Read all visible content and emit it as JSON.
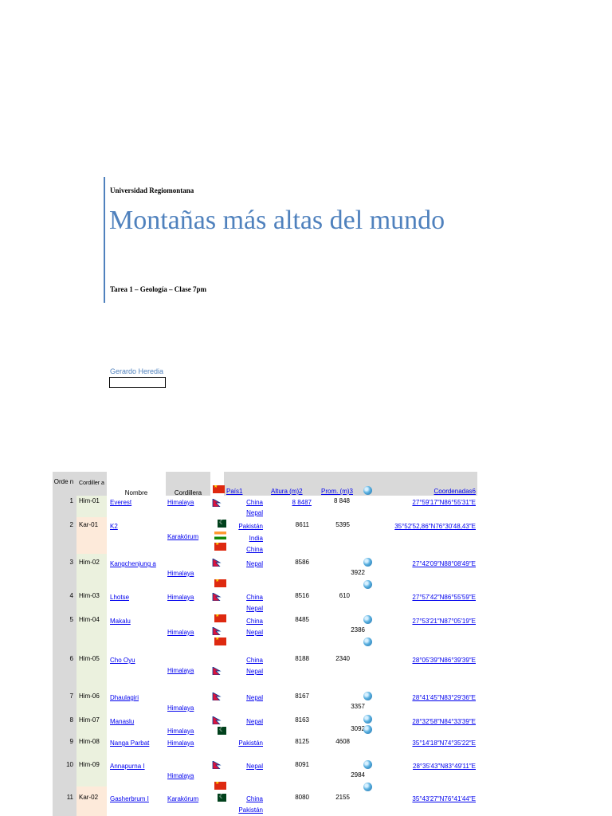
{
  "cover": {
    "organization": "Universidad Regiomontana",
    "title": "Montañas más altas del mundo",
    "subtitle": "Tarea 1 – Geología – Clase 7pm",
    "author": "Gerardo Heredia"
  },
  "table": {
    "headers": {
      "orden": "Orde n",
      "cordillera_code": "Cordiller a",
      "nombre": "Nombre",
      "cordillera": "Cordillera",
      "pais": "País1",
      "altura": "Altura (m)2",
      "prominencia": "Prom. (m)3",
      "coordenadas": "Coordenadas6"
    },
    "rows": [
      {
        "orden": "1",
        "code": "Him-01",
        "nombre": "Everest",
        "cordillera": "Himalaya",
        "paises": [
          "China",
          "Nepal"
        ],
        "altura": "8 8487",
        "prom": "8 848",
        "coord": "27°59′17″N86°55′31″E"
      },
      {
        "orden": "2",
        "code": "Kar-01",
        "nombre": "K2",
        "cordillera": "Karakórum",
        "paises": [
          "Pakistán",
          "India",
          "China"
        ],
        "altura": "8611",
        "prom": "5395",
        "coord": "35°52′52,86″N76°30′48,43″E"
      },
      {
        "orden": "3",
        "code": "Him-02",
        "nombre": "Kangchenjung a",
        "cordillera": "Himalaya",
        "paises": [
          "Nepal"
        ],
        "altura": "8586",
        "prom": "3922",
        "coord": "27°42′09″N88°08′49″E"
      },
      {
        "orden": "4",
        "code": "Him-03",
        "nombre": "Lhotse",
        "cordillera": "Himalaya",
        "paises": [
          "China",
          "Nepal"
        ],
        "altura": "8516",
        "prom": "610",
        "coord": "27°57′42″N86°55′59″E"
      },
      {
        "orden": "5",
        "code": "Him-04",
        "nombre": "Makalu",
        "cordillera": "Himalaya",
        "paises": [
          "China",
          "Nepal"
        ],
        "altura": "8485",
        "prom": "2386",
        "coord": "27°53′21″N87°05′19″E"
      },
      {
        "orden": "6",
        "code": "Him-05",
        "nombre": "Cho Oyu",
        "cordillera": "Himalaya",
        "paises": [
          "China",
          "Nepal"
        ],
        "altura": "8188",
        "prom": "2340",
        "coord": "28°05′39″N86°39′39″E"
      },
      {
        "orden": "7",
        "code": "Him-06",
        "nombre": "Dhaulagiri",
        "cordillera": "Himalaya",
        "paises": [
          "Nepal"
        ],
        "altura": "8167",
        "prom": "3357",
        "coord": "28°41′45″N83°29′36″E"
      },
      {
        "orden": "8",
        "code": "Him-07",
        "nombre": "Manaslu",
        "cordillera": "Himalaya",
        "paises": [
          "Nepal"
        ],
        "altura": "8163",
        "prom": "3092",
        "coord": "28°32′58″N84°33′39″E"
      },
      {
        "orden": "9",
        "code": "Him-08",
        "nombre": "Nanga Parbat",
        "cordillera": "Himalaya",
        "paises": [
          "Pakistán"
        ],
        "altura": "8125",
        "prom": "4608",
        "coord": "35°14′18″N74°35′22″E"
      },
      {
        "orden": "10",
        "code": "Him-09",
        "nombre": "Annapurna I",
        "cordillera": "Himalaya",
        "paises": [
          "Nepal"
        ],
        "altura": "8091",
        "prom": "2984",
        "coord": "28°35′43″N83°49′11″E"
      },
      {
        "orden": "11",
        "code": "Kar-02",
        "nombre": "Gasherbrum I",
        "cordillera": "Karakórum",
        "paises": [
          "China",
          "Pakistán"
        ],
        "altura": "8080",
        "prom": "2155",
        "coord": "35°43′27″N76°41′44″E"
      }
    ]
  },
  "icons": {
    "china": "china-flag-icon",
    "nepal": "nepal-flag-icon",
    "pakistan": "pakistan-flag-icon",
    "india": "india-flag-icon",
    "globe": "globe-icon"
  },
  "colors": {
    "accent": "#4f81bd",
    "link": "#0000ee",
    "header": "#d9d9d9",
    "col_orden": "#d9d9d9",
    "col_code_kar": "#fdeada",
    "col_code_him": "#ebf1de"
  }
}
